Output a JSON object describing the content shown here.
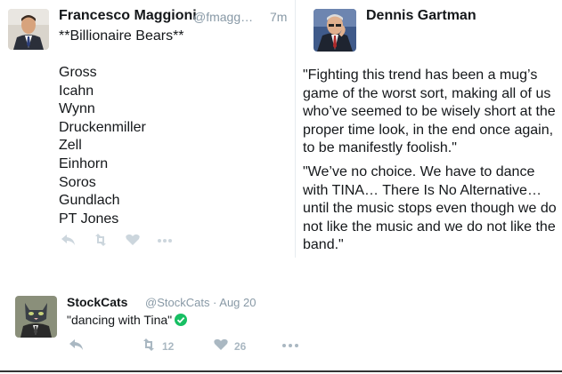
{
  "tweet1": {
    "name": "Francesco Maggioni",
    "handle": "@fmagg…",
    "time": "7m",
    "headline": "**Billionaire Bears**",
    "names": [
      "Gross",
      "Icahn",
      "Wynn",
      "Druckenmiller",
      "Zell",
      "Einhorn",
      "Soros",
      "Gundlach",
      "PT Jones"
    ]
  },
  "quote": {
    "name": "Dennis Gartman",
    "para1": "\"Fighting this trend has been a mug’s game of the worst sort, making all of us who’ve seemed to be wisely short at the proper time look, in the end once again, to be manifestly foolish.\"",
    "para2": "\"We’ve no choice. We have to dance with TINA… There Is No Alternative…until the music stops even though we do not like the music and we do not like the band.\""
  },
  "tweet2": {
    "name": "StockCats",
    "handle_time": "@StockCats · Aug 20",
    "text": "\"dancing with Tina\"",
    "retweets": "12",
    "likes": "26"
  },
  "colors": {
    "icon": "#aab8c2",
    "handle": "#8899a6",
    "verified": "#17bf63"
  },
  "icons": [
    "reply-icon",
    "retweet-icon",
    "heart-icon",
    "more-icon",
    "checkmark-icon"
  ]
}
